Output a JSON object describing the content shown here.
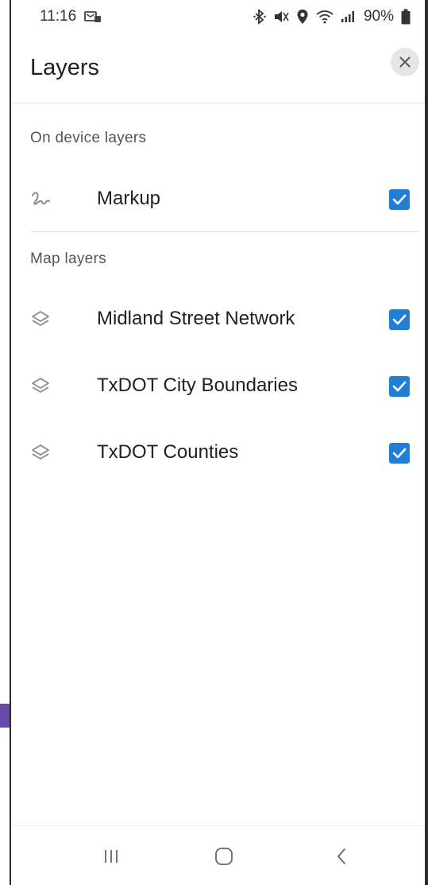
{
  "status_bar": {
    "time": "11:16",
    "battery": "90%",
    "icons": [
      "message-notification-icon",
      "bluetooth-icon",
      "mute-icon",
      "location-icon",
      "wifi-icon",
      "signal-icon",
      "battery-icon"
    ]
  },
  "header": {
    "title": "Layers",
    "close_icon": "close-icon"
  },
  "sections": {
    "on_device": {
      "label": "On device layers",
      "items": [
        {
          "label": "Markup",
          "icon": "markup-icon",
          "checked": true
        }
      ]
    },
    "map_layers": {
      "label": "Map layers",
      "items": [
        {
          "label": "Midland Street Network",
          "icon": "layers-icon",
          "checked": true
        },
        {
          "label": "TxDOT City Boundaries",
          "icon": "layers-icon",
          "checked": true
        },
        {
          "label": "TxDOT Counties",
          "icon": "layers-icon",
          "checked": true
        }
      ]
    }
  },
  "nav_bar": {
    "buttons": [
      "recent-apps-icon",
      "home-icon",
      "back-icon"
    ]
  },
  "colors": {
    "checkbox": "#1f7fd4",
    "accent_edge": "#6a4aa8"
  }
}
